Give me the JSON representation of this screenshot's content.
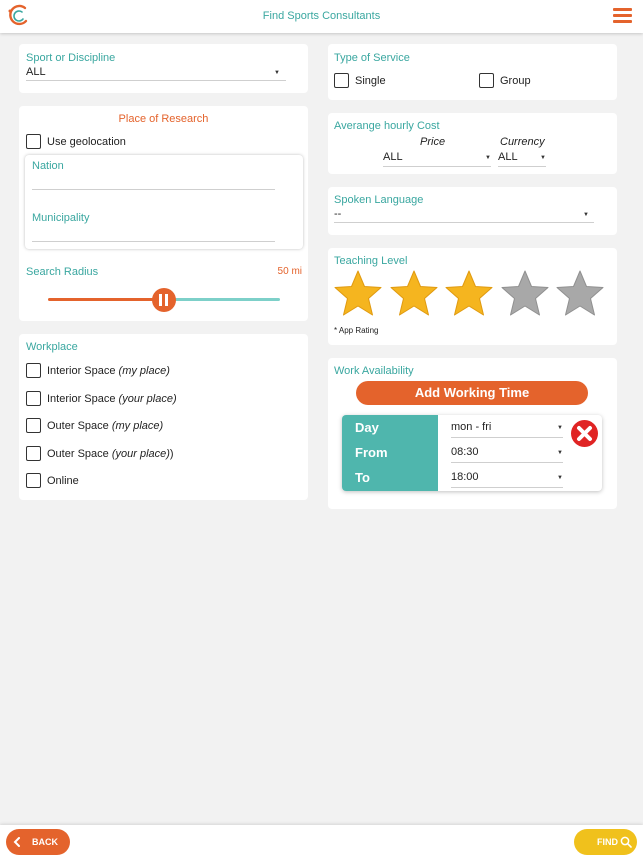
{
  "header": {
    "title": "Find Sports Consultants"
  },
  "sport": {
    "label": "Sport or Discipline",
    "value": "ALL"
  },
  "place": {
    "title": "Place of Research",
    "geolocation_label": "Use geolocation",
    "nation_label": "Nation",
    "municipality_label": "Municipality",
    "radius_label": "Search Radius",
    "radius_value": "50 mi",
    "radius_fraction": 0.5
  },
  "workplace": {
    "title": "Workplace",
    "options": [
      {
        "main": "Interior Space",
        "italic": "(my place)",
        "suffix": ""
      },
      {
        "main": "Interior Space",
        "italic": "(your place)",
        "suffix": ""
      },
      {
        "main": "Outer Space",
        "italic": "(my place)",
        "suffix": ""
      },
      {
        "main": "Outer Space",
        "italic": "(your place)",
        "suffix": ")"
      },
      {
        "main": "Online",
        "italic": "",
        "suffix": ""
      }
    ]
  },
  "service": {
    "title": "Type of Service",
    "single": "Single",
    "group": "Group"
  },
  "cost": {
    "title": "Averange hourly Cost",
    "price_label": "Price",
    "price_value": "ALL",
    "currency_label": "Currency",
    "currency_value": "ALL"
  },
  "language": {
    "title": "Spoken Language",
    "value": "--"
  },
  "teaching": {
    "title": "Teaching Level",
    "note": "* App Rating",
    "rating": 3,
    "max": 5
  },
  "availability": {
    "title": "Work Availability",
    "add_label": "Add Working Time",
    "day_label": "Day",
    "day_value": "mon - fri",
    "from_label": "From",
    "from_value": "08:30",
    "to_label": "To",
    "to_value": "18:00"
  },
  "footer": {
    "back_label": "BACK",
    "find_label": "FIND"
  },
  "colors": {
    "accent": "#e4632c",
    "teal": "#3aa7a0",
    "find": "#f0c11c",
    "star_on": "#f5b51f",
    "star_off": "#a8a8a8",
    "close": "#e02424"
  }
}
